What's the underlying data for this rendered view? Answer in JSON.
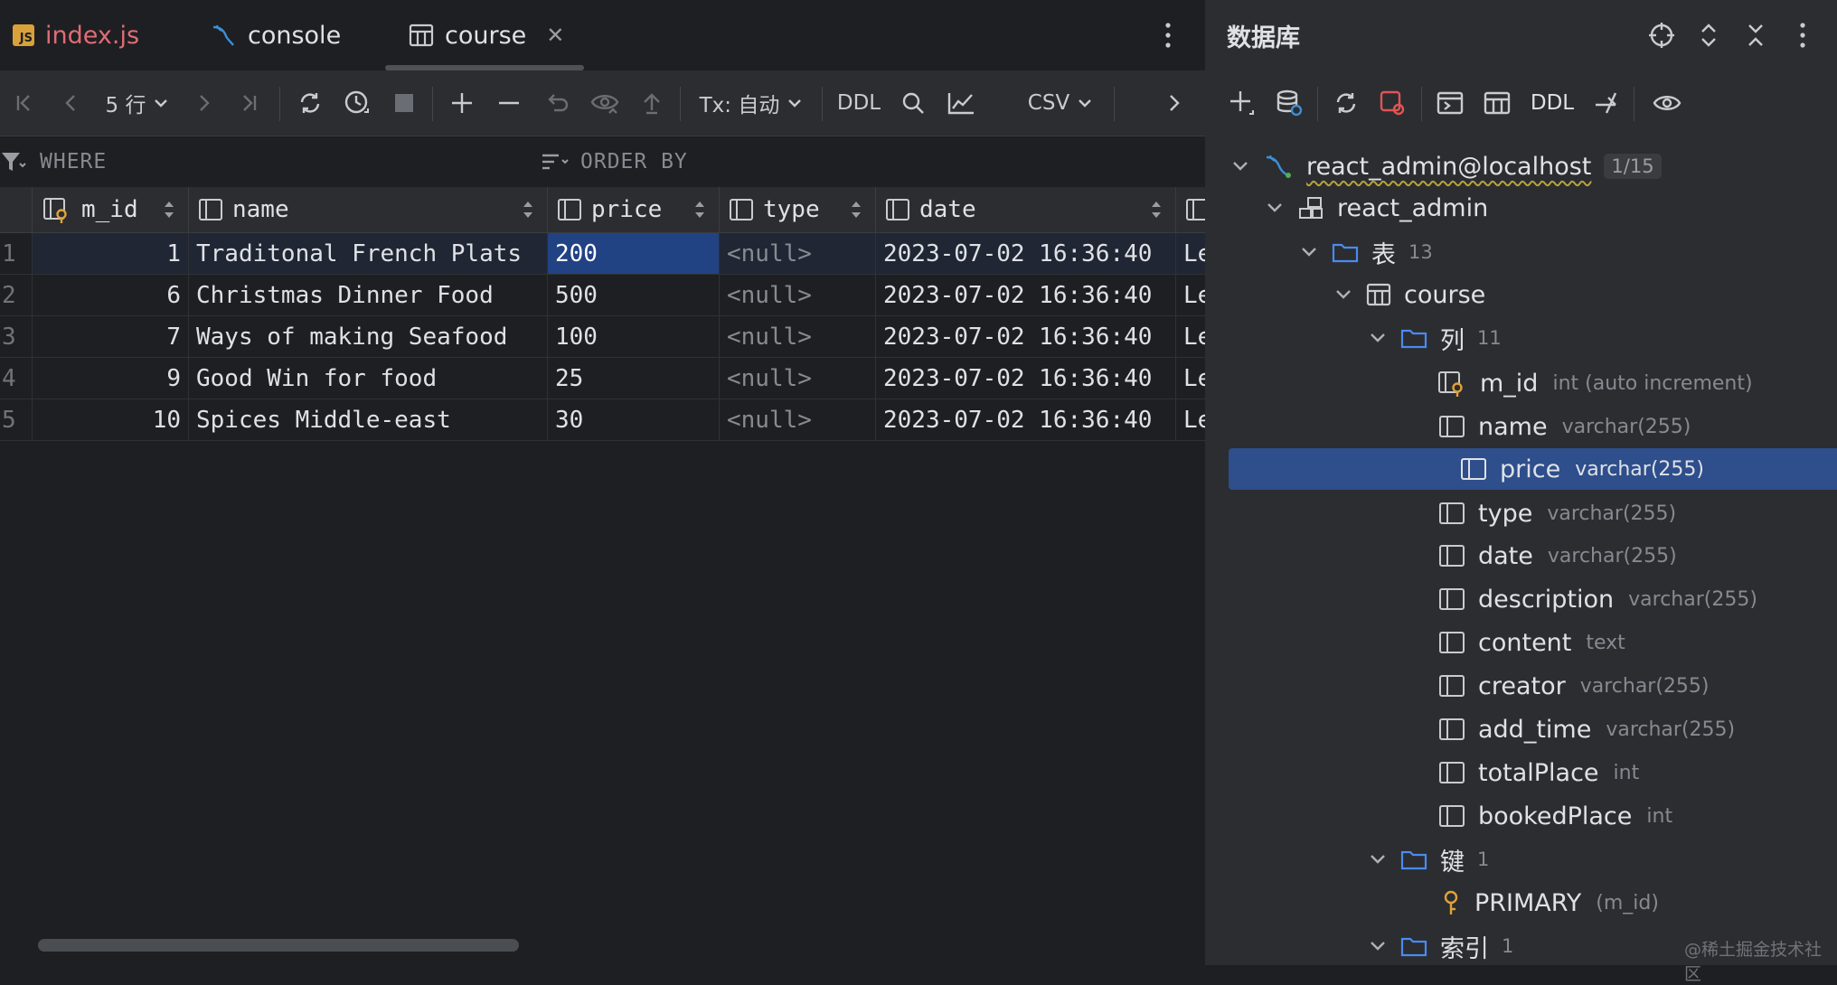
{
  "tabs": [
    {
      "label": "index.js",
      "icon": "js-file-icon"
    },
    {
      "label": "console",
      "icon": "mysql-console-icon"
    },
    {
      "label": "course",
      "icon": "table-icon",
      "active": true
    }
  ],
  "toolbar": {
    "rows_label": "5 行",
    "tx_label": "Tx: 自动",
    "ddl_label": "DDL",
    "export_label": "CSV"
  },
  "filter": {
    "where_label": "WHERE",
    "order_label": "ORDER BY"
  },
  "grid": {
    "columns": [
      "m_id",
      "name",
      "price",
      "type",
      "date"
    ],
    "rows": [
      {
        "n": "1",
        "m_id": "1",
        "name": "Traditonal French Plats",
        "price": "200",
        "type": "<null>",
        "date": "2023-07-02 16:36:40",
        "extra": "Le"
      },
      {
        "n": "2",
        "m_id": "6",
        "name": "Christmas Dinner Food",
        "price": "500",
        "type": "<null>",
        "date": "2023-07-02 16:36:40",
        "extra": "Le"
      },
      {
        "n": "3",
        "m_id": "7",
        "name": "Ways of making Seafood",
        "price": "100",
        "type": "<null>",
        "date": "2023-07-02 16:36:40",
        "extra": "Le"
      },
      {
        "n": "4",
        "m_id": "9",
        "name": "Good Win for food",
        "price": "25",
        "type": "<null>",
        "date": "2023-07-02 16:36:40",
        "extra": "Le"
      },
      {
        "n": "5",
        "m_id": "10",
        "name": "Spices Middle-east",
        "price": "30",
        "type": "<null>",
        "date": "2023-07-02 16:36:40",
        "extra": "Le"
      }
    ]
  },
  "panel": {
    "title": "数据库",
    "ddl_label": "DDL",
    "connection": {
      "label": "react_admin@localhost",
      "badge": "1/15"
    },
    "schema": "react_admin",
    "tables_folder": {
      "label": "表",
      "count": "13"
    },
    "table": "course",
    "columns_folder": {
      "label": "列",
      "count": "11"
    },
    "columns": [
      {
        "name": "m_id",
        "type": "int (auto increment)",
        "key": true
      },
      {
        "name": "name",
        "type": "varchar(255)"
      },
      {
        "name": "price",
        "type": "varchar(255)",
        "selected": true
      },
      {
        "name": "type",
        "type": "varchar(255)"
      },
      {
        "name": "date",
        "type": "varchar(255)"
      },
      {
        "name": "description",
        "type": "varchar(255)"
      },
      {
        "name": "content",
        "type": "text"
      },
      {
        "name": "creator",
        "type": "varchar(255)"
      },
      {
        "name": "add_time",
        "type": "varchar(255)"
      },
      {
        "name": "totalPlace",
        "type": "int"
      },
      {
        "name": "bookedPlace",
        "type": "int"
      }
    ],
    "keys_folder": {
      "label": "键",
      "count": "1"
    },
    "primary_key": {
      "name": "PRIMARY",
      "cols": "(m_id)"
    },
    "indexes_folder": {
      "label": "索引",
      "count": "1"
    }
  },
  "watermark": "@稀土掘金技术社区",
  "colors": {
    "selection": "#214283",
    "tree_selection": "#2e4e8c",
    "folder": "#4a8bf0",
    "accent_red": "#e06c75"
  }
}
